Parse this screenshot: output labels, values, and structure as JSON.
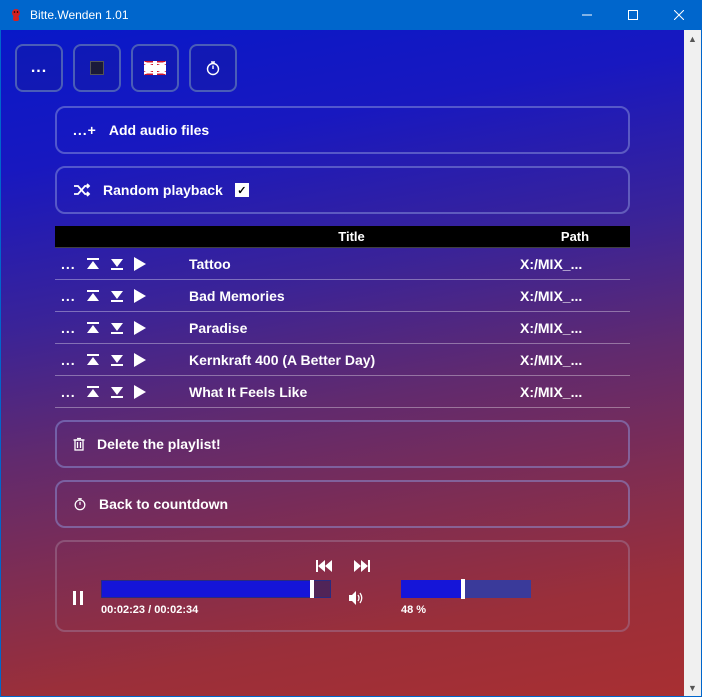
{
  "window": {
    "title": "Bitte.Wenden 1.01"
  },
  "toolbar": {
    "menu_dots": "...",
    "add_label": "Add audio files",
    "add_prefix": "...+",
    "random_label": "Random playback",
    "random_checked": true
  },
  "table": {
    "headers": {
      "title": "Title",
      "path": "Path"
    },
    "rows": [
      {
        "title": "Tattoo",
        "path": "X:/MIX_..."
      },
      {
        "title": "Bad Memories",
        "path": "X:/MIX_..."
      },
      {
        "title": "Paradise",
        "path": "X:/MIX_..."
      },
      {
        "title": "Kernkraft 400 (A Better Day)",
        "path": "X:/MIX_..."
      },
      {
        "title": "What It Feels Like",
        "path": "X:/MIX_..."
      }
    ]
  },
  "delete_label": "Delete the playlist!",
  "back_label": "Back to countdown",
  "player": {
    "time": "00:02:23 / 00:02:34",
    "progress_pct": 92,
    "volume_pct": 48,
    "volume_label": "48 %"
  }
}
